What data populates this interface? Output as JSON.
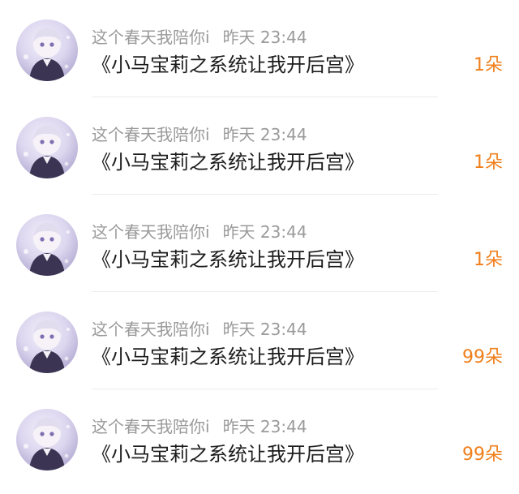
{
  "items": [
    {
      "username": "这个春天我陪你i",
      "time": "昨天 23:44",
      "message": "《小马宝莉之系统让我开后宫》",
      "count": "1朵"
    },
    {
      "username": "这个春天我陪你i",
      "time": "昨天 23:44",
      "message": "《小马宝莉之系统让我开后宫》",
      "count": "1朵"
    },
    {
      "username": "这个春天我陪你i",
      "time": "昨天 23:44",
      "message": "《小马宝莉之系统让我开后宫》",
      "count": "1朵"
    },
    {
      "username": "这个春天我陪你i",
      "time": "昨天 23:44",
      "message": "《小马宝莉之系统让我开后宫》",
      "count": "99朵"
    },
    {
      "username": "这个春天我陪你i",
      "time": "昨天 23:44",
      "message": "《小马宝莉之系统让我开后宫》",
      "count": "99朵"
    }
  ],
  "colors": {
    "count": "#f07f1c",
    "meta": "#9a9a9a",
    "message": "#1c1c1c"
  }
}
